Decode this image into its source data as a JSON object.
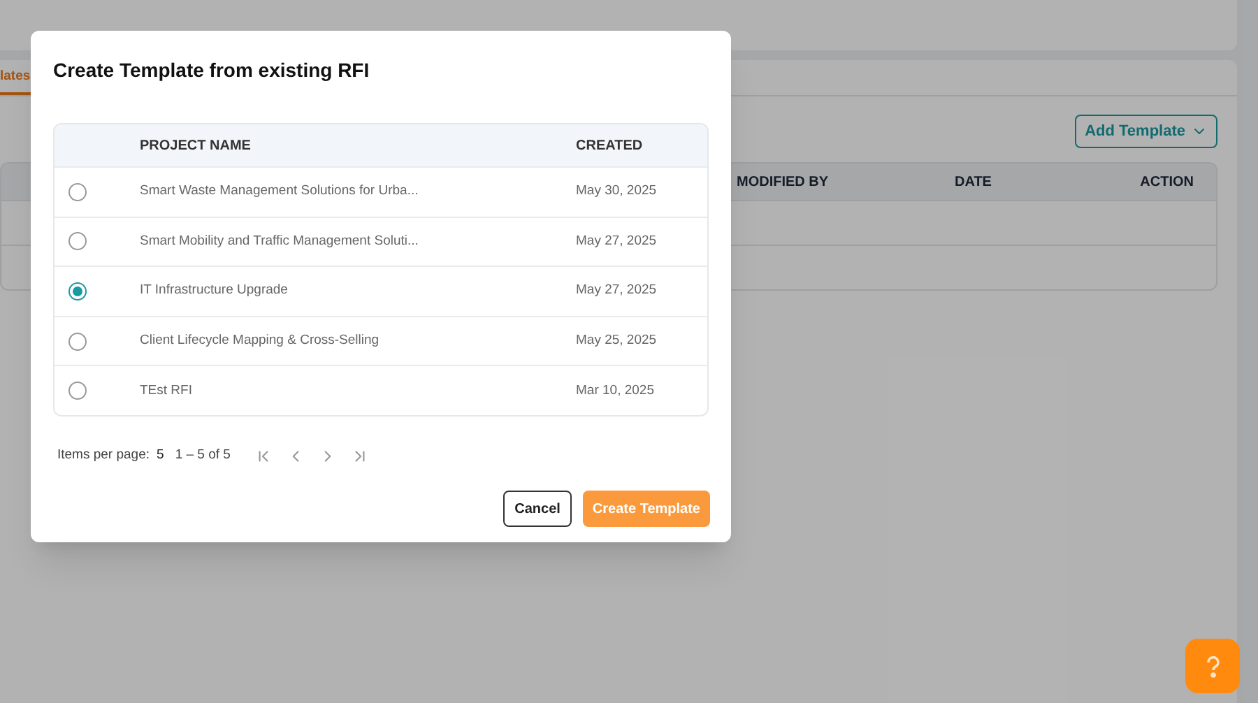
{
  "page": {
    "tab": {
      "label": "lates",
      "selected": true
    },
    "add_button": {
      "label": "Add Template"
    },
    "table": {
      "columns": [
        "MODIFIED BY",
        "DATE",
        "ACTION"
      ],
      "row_count_rows": [
        {},
        {}
      ]
    }
  },
  "dialog": {
    "title": "Create Template from existing RFI",
    "columns": [
      "PROJECT NAME",
      "CREATED"
    ],
    "rows": [
      {
        "name": "Smart Waste Management Solutions for Urba...",
        "created": "May 30, 2025",
        "selected": false
      },
      {
        "name": "Smart Mobility and Traffic Management Soluti...",
        "created": "May 27, 2025",
        "selected": false
      },
      {
        "name": "IT Infrastructure Upgrade",
        "created": "May 27, 2025",
        "selected": true
      },
      {
        "name": "Client Lifecycle Mapping & Cross-Selling",
        "created": "May 25, 2025",
        "selected": false
      },
      {
        "name": "TEst RFI",
        "created": "Mar 10, 2025",
        "selected": false
      }
    ],
    "pagination": {
      "label": "Items per page:",
      "page_size": "5",
      "range": "1 – 5 of 5"
    },
    "buttons": {
      "cancel": "Cancel",
      "confirm": "Create Template"
    }
  }
}
